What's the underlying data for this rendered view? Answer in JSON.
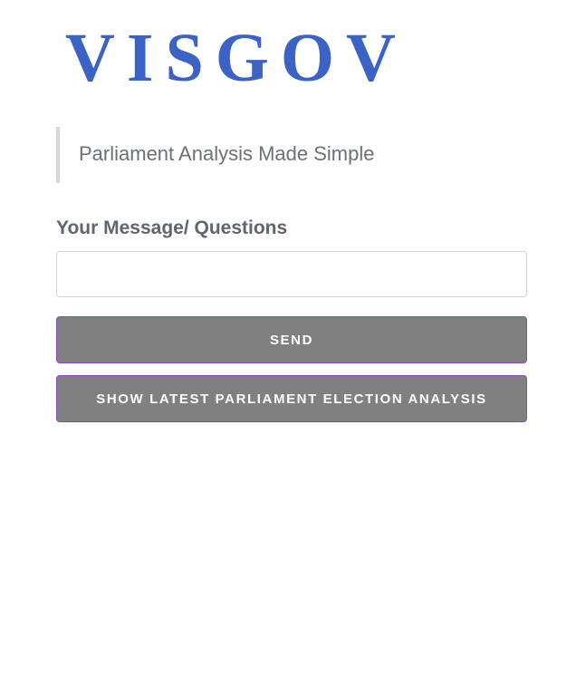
{
  "logo": {
    "text": "VISGOV",
    "color": "#3a63c5"
  },
  "tagline": "Parliament Analysis Made Simple",
  "form": {
    "label": "Your Message/ Questions",
    "message_value": "",
    "message_placeholder": ""
  },
  "buttons": {
    "send_label": "SEND",
    "analysis_label": "SHOW LATEST PARLIAMENT ELECTION ANALYSIS",
    "background_color": "#808080",
    "border_color": "#8e4bb3"
  }
}
